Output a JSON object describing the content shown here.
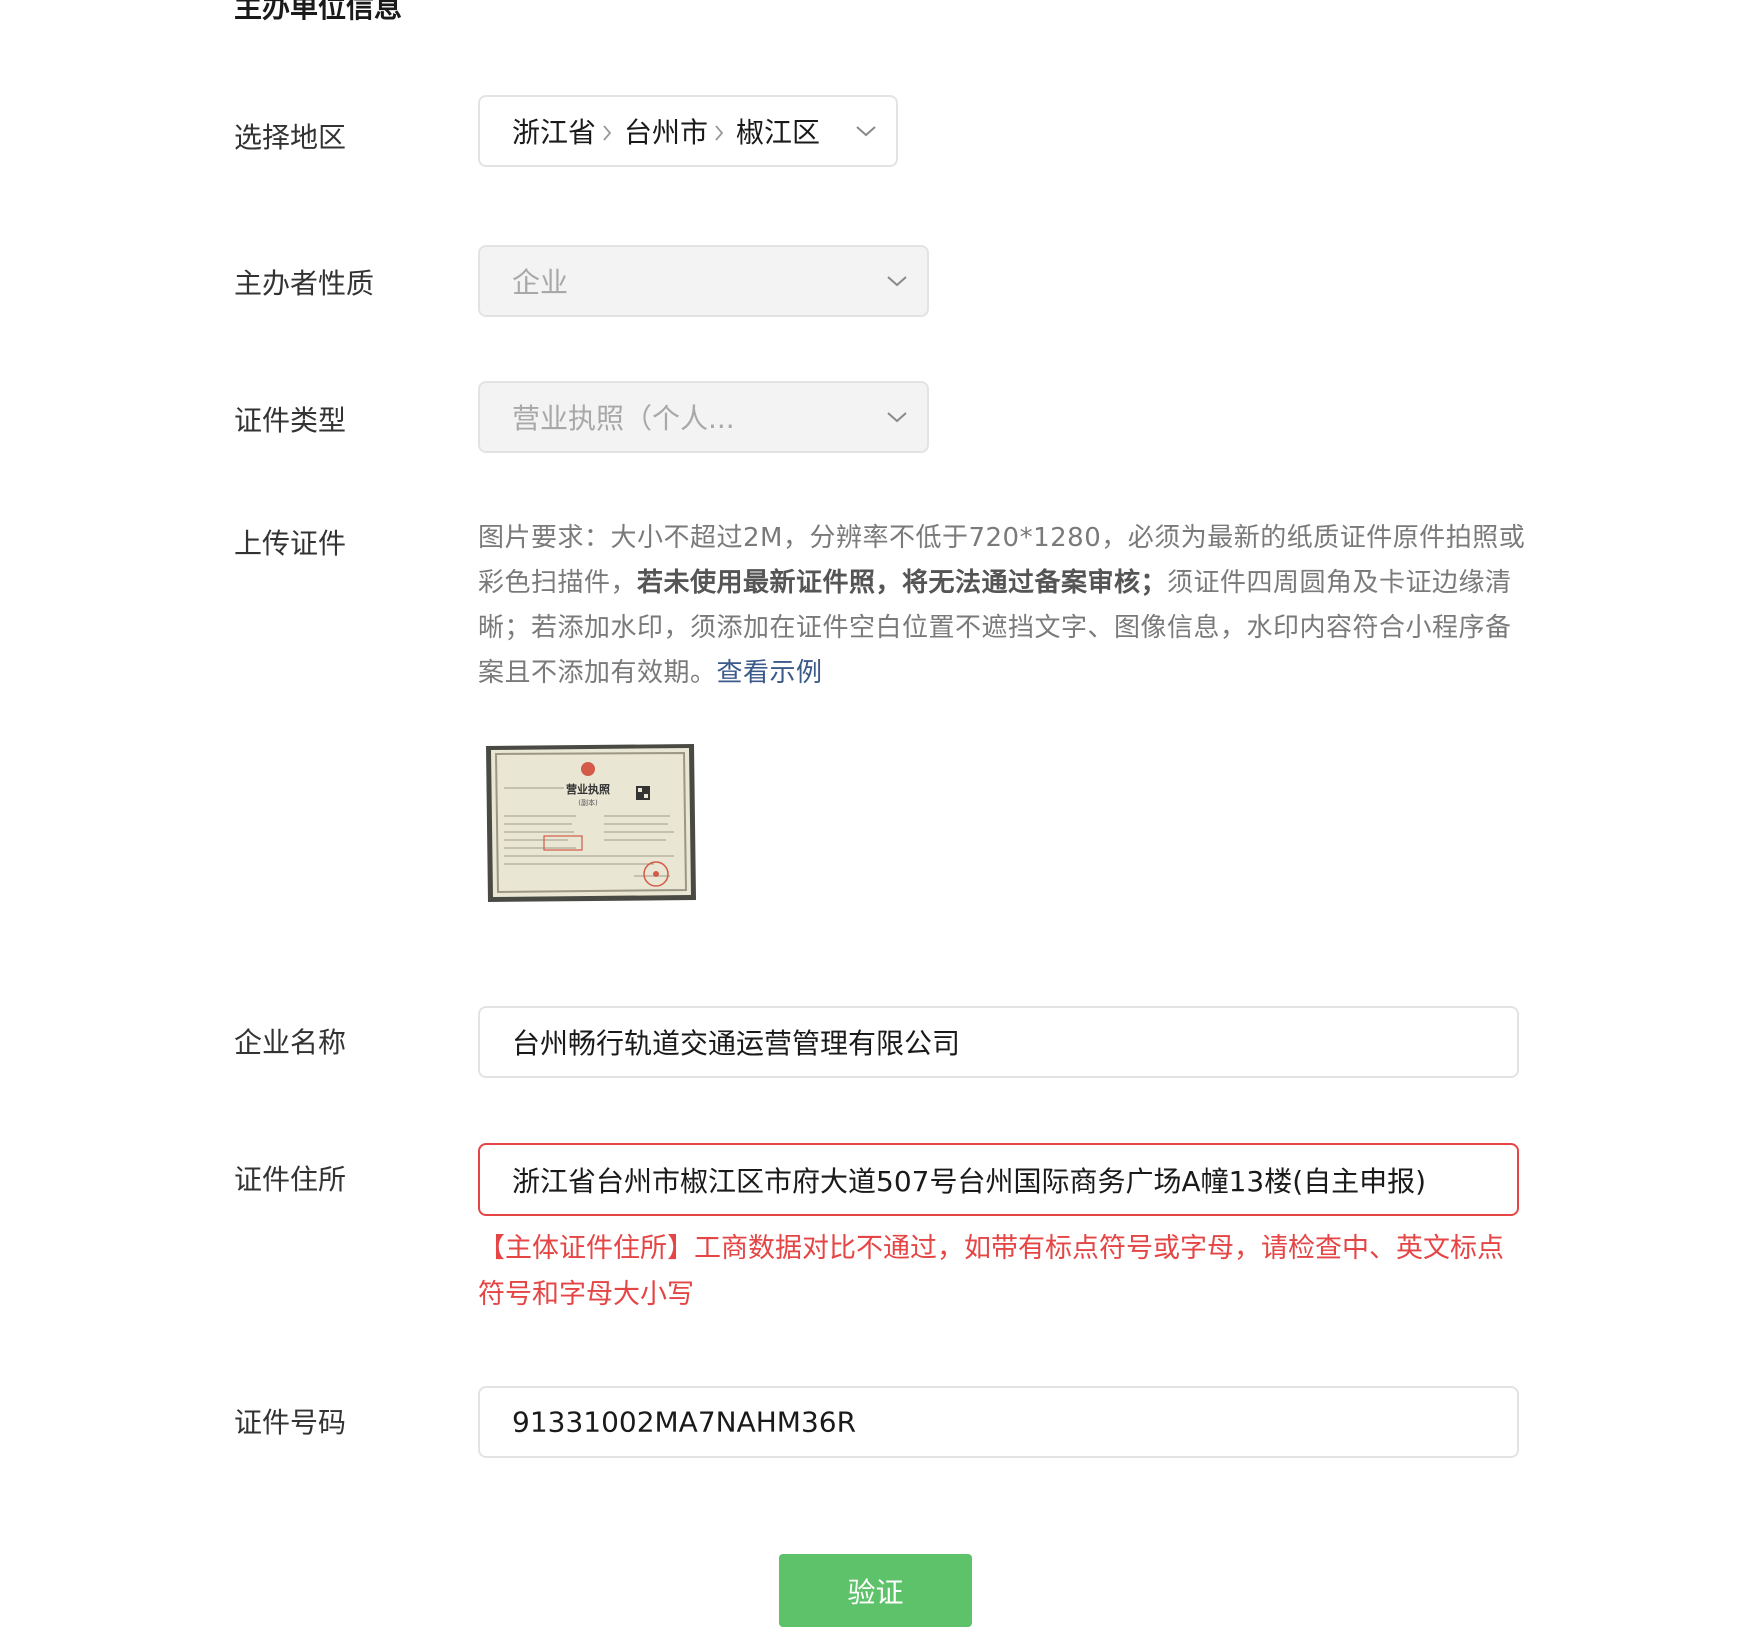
{
  "section": {
    "title": "主办单位信息"
  },
  "labels": {
    "region": "选择地区",
    "nature": "主办者性质",
    "cert_type": "证件类型",
    "upload": "上传证件",
    "company_name": "企业名称",
    "cert_address": "证件住所",
    "cert_number": "证件号码"
  },
  "region": {
    "province": "浙江省",
    "city": "台州市",
    "district": "椒江区"
  },
  "nature": {
    "value": "企业"
  },
  "cert_type": {
    "value": "营业执照（个人..."
  },
  "upload": {
    "desc_1": "图片要求：大小不超过2M，分辨率不低于720*1280，必须为最新的纸质证件原件拍照或彩色扫描件，",
    "desc_bold": "若未使用最新证件照，将无法通过备案审核；",
    "desc_2": "须证件四周圆角及卡证边缘清晰；若添加水印，须添加在证件空白位置不遮挡文字、图像信息，水印内容符合小程序备案且不添加有效期。",
    "example_link": "查看示例",
    "thumb_text": {
      "title": "营业执照",
      "subtitle": "(副本)"
    }
  },
  "company_name": {
    "value": "台州畅行轨道交通运营管理有限公司"
  },
  "cert_address": {
    "value": "浙江省台州市椒江区市府大道507号台州国际商务广场A幢13楼(自主申报)",
    "error": "【主体证件住所】工商数据对比不通过，如带有标点符号或字母，请检查中、英文标点符号和字母大小写"
  },
  "cert_number": {
    "value": "91331002MA7NAHM36R"
  },
  "actions": {
    "verify": "验证"
  },
  "colors": {
    "error": "#e54545",
    "primary_button": "#5ec26a",
    "link": "#3b5a8a"
  }
}
